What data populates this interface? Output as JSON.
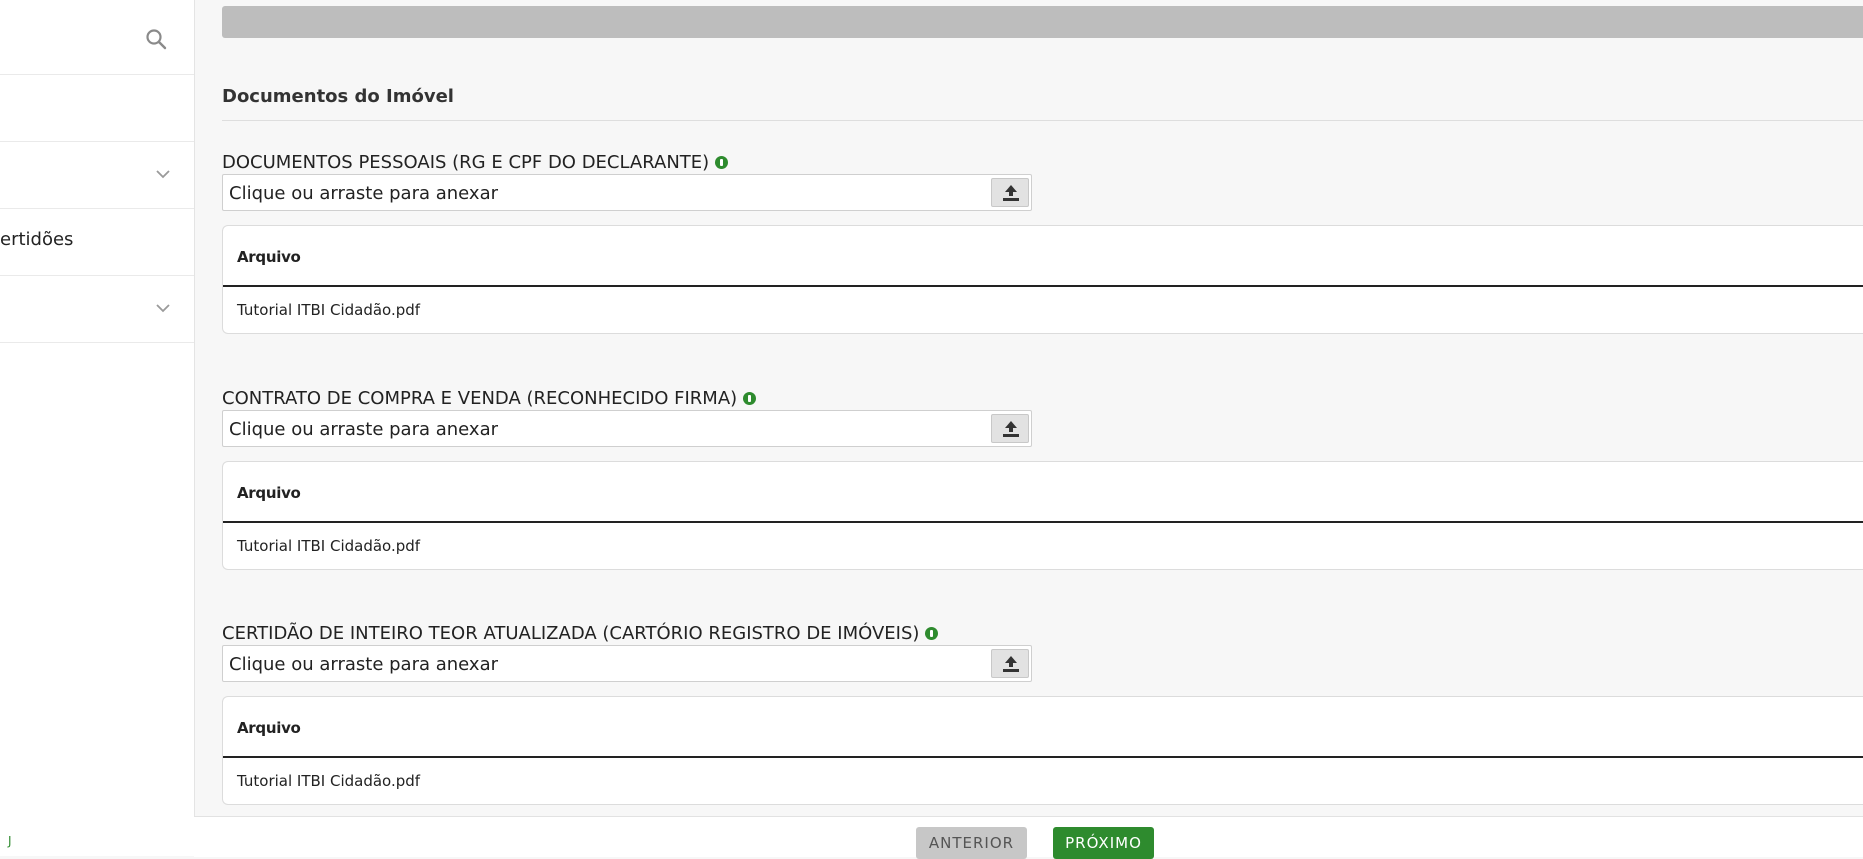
{
  "sidebar": {
    "items": [
      {
        "label": ""
      },
      {
        "label": ""
      },
      {
        "label": "ertidões"
      },
      {
        "label": ""
      }
    ],
    "footer_mark": "J"
  },
  "main": {
    "section_title": "Documentos do Imóvel",
    "documents": [
      {
        "label": "DOCUMENTOS PESSOAIS (RG E CPF DO DECLARANTE)",
        "placeholder": "Clique ou arraste para anexar",
        "column_header": "Arquivo",
        "file": "Tutorial ITBI Cidadão.pdf"
      },
      {
        "label": "CONTRATO DE COMPRA E VENDA (RECONHECIDO FIRMA)",
        "placeholder": "Clique ou arraste para anexar",
        "column_header": "Arquivo",
        "file": "Tutorial ITBI Cidadão.pdf"
      },
      {
        "label": "CERTIDÃO DE INTEIRO TEOR ATUALIZADA (CARTÓRIO REGISTRO DE IMÓVEIS)",
        "placeholder": "Clique ou arraste para anexar",
        "column_header": "Arquivo",
        "file": "Tutorial ITBI Cidadão.pdf"
      }
    ]
  },
  "nav": {
    "prev_label": "ANTERIOR",
    "next_label": "PRÓXIMO"
  },
  "colors": {
    "accent": "#2e8b2e",
    "disabled": "#c7c7c7"
  },
  "icons": {
    "search": "search-icon",
    "chevron": "chevron-down-icon",
    "upload": "upload-icon",
    "help": "help-icon"
  }
}
